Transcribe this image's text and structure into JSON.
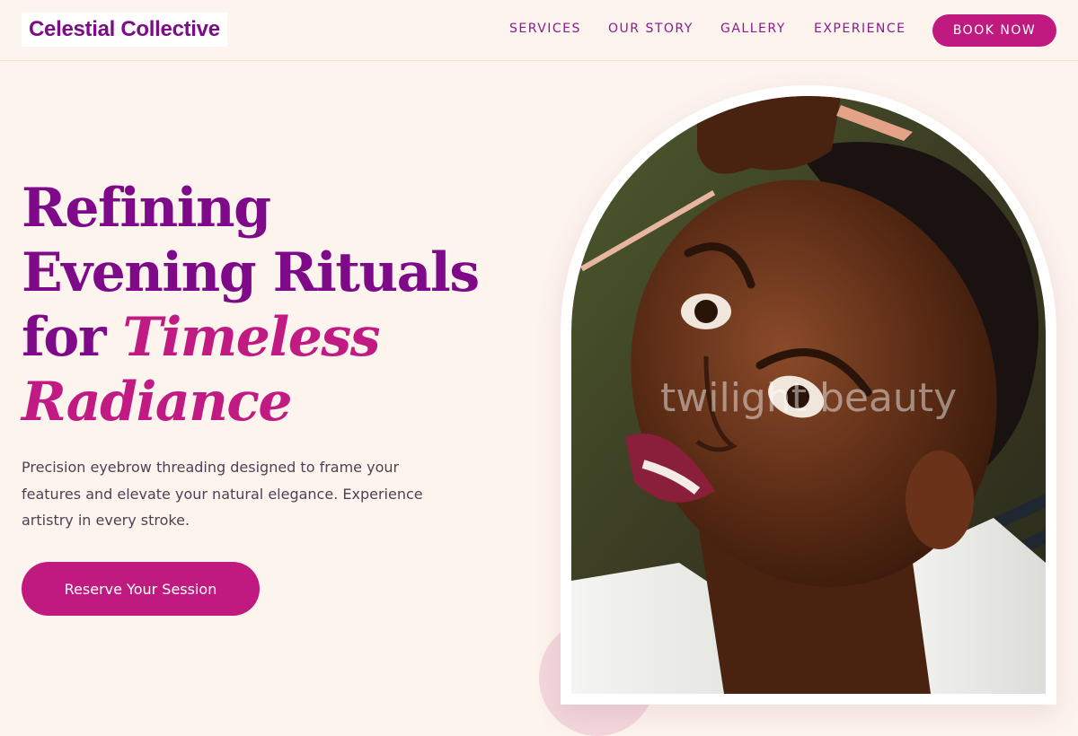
{
  "brand": {
    "name": "Celestial Collective"
  },
  "nav": {
    "items": [
      {
        "label": "SERVICES"
      },
      {
        "label": "OUR STORY"
      },
      {
        "label": "GALLERY"
      },
      {
        "label": "EXPERIENCE"
      }
    ],
    "book_label": "BOOK NOW"
  },
  "hero": {
    "title_line1": "Refining",
    "title_line2": "Evening Rituals",
    "title_line3_plain": "for ",
    "title_line3_em": "Timeless",
    "title_line4_em": "Radiance",
    "description": "Precision eyebrow threading designed to frame your features and elevate your natural elegance. Experience artistry in every stroke.",
    "cta_label": "Reserve Your Session"
  },
  "image": {
    "watermark": "twilight beauty"
  },
  "colors": {
    "brand_purple": "#7e0a8a",
    "accent_magenta": "#c0197f",
    "background_cream": "#fdf4ee"
  }
}
